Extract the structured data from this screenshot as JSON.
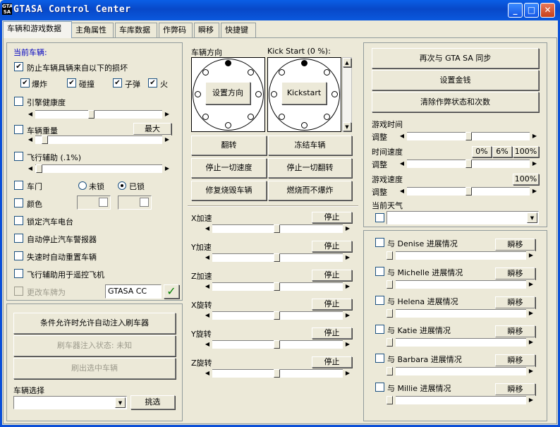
{
  "window": {
    "title": "GTASA Control Center",
    "icon_text": "GTA SA",
    "minimize": "_",
    "maximize": "□",
    "close": "✕"
  },
  "tabs": [
    "车辆和游戏数据",
    "主角属性",
    "车库数据",
    "作弊码",
    "瞬移",
    "快捷键"
  ],
  "left": {
    "current_vehicle": "当前车辆:",
    "protect_label": "防止车辆具辆来自以下的损坏",
    "damage": {
      "explosion": "爆炸",
      "collision": "碰撞",
      "bullet": "子弹",
      "fire": "火"
    },
    "engine_health": "引擎健康度",
    "vehicle_weight": "车辆重量",
    "max_button": "最大",
    "flight_assist": "飞行辅助 (.1%)",
    "doors": "车门",
    "unlocked": "未锁",
    "locked": "已锁",
    "color": "颜色",
    "lock_radio": "锁定汽车电台",
    "auto_stop_alarm": "自动停止汽车警报器",
    "auto_reset": "失速时自动重置车辆",
    "flight_remote": "飞行辅助用于遥控飞机",
    "change_plate": "更改车牌为",
    "plate_value": "GTASA CC",
    "checkmark": "✓",
    "inject_cond": "条件允许时允许自动注入刷车器",
    "injector_status": "刷车器注入状态: 未知",
    "spawn_vehicle": "刷出选中车辆",
    "vehicle_select": "车辆选择",
    "pick_button": "挑选"
  },
  "middle": {
    "direction_label": "车辆方向",
    "kickstart_label": "Kick Start (0 %):",
    "set_direction": "设置方向",
    "kickstart": "Kickstart",
    "flip": "翻转",
    "freeze": "冻结车辆",
    "stop_speed": "停止一切速度",
    "stop_flip": "停止一切翻转",
    "repair": "修复烧毁车辆",
    "burn_no_explode": "燃烧而不爆炸",
    "stop": "停止",
    "axes": [
      "X加速",
      "Y加速",
      "Z加速",
      "X旋转",
      "Y旋转",
      "Z旋转"
    ]
  },
  "right": {
    "resync": "再次与 GTA SA 同步",
    "set_money": "设置金钱",
    "clear_cheats": "清除作弊状态和次数",
    "game_time": "游戏时间",
    "adjust": "调整",
    "time_speed": "时间速度",
    "pct0": "0%",
    "pct6": "6%",
    "pct100": "100%",
    "game_speed": "游戏速度",
    "game_speed_pct": "100%",
    "weather": "当前天气",
    "teleport": "瞬移",
    "girlfriends": [
      "与 Denise 进展情况",
      "与 Michelle 进展情况",
      "与 Helena 进展情况",
      "与 Katie 进展情况",
      "与 Barbara 进展情况",
      "与 Millie 进展情况"
    ]
  },
  "glyphs": {
    "check": "✔",
    "left": "◀",
    "right": "▶",
    "up": "▲",
    "down": "▼"
  }
}
